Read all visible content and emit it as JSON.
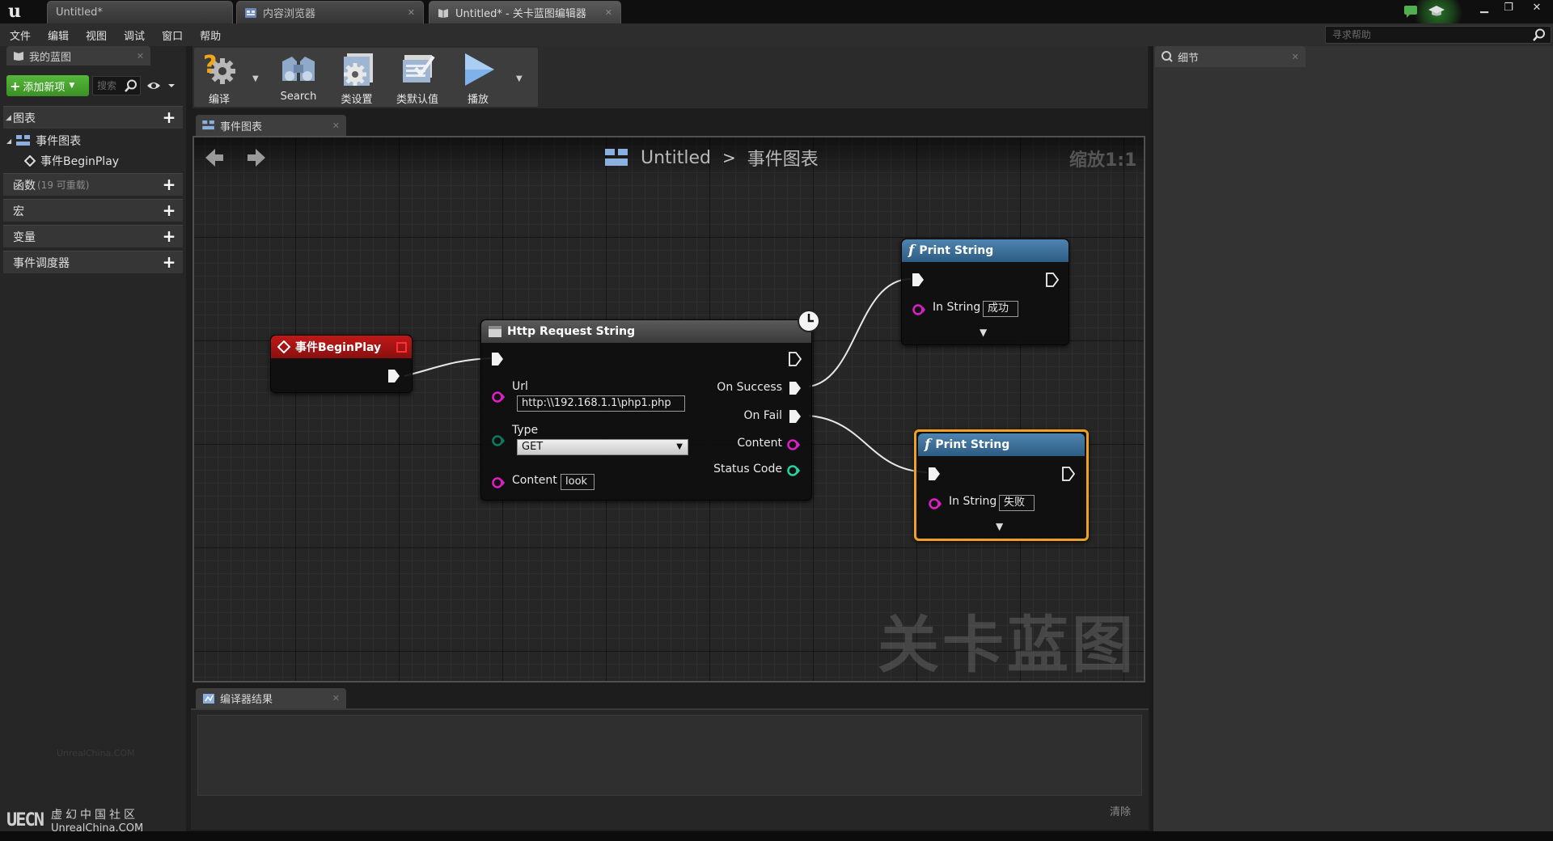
{
  "window": {
    "tabs": [
      {
        "label": "Untitled*"
      },
      {
        "label": "内容浏览器"
      },
      {
        "label": "Untitled* - 关卡蓝图编辑器"
      }
    ],
    "logo": "u"
  },
  "menu": [
    "文件",
    "编辑",
    "视图",
    "调试",
    "窗口",
    "帮助"
  ],
  "help_search_placeholder": "寻求帮助",
  "left_panel": {
    "tab_label": "我的蓝图",
    "add_button": "添加新项",
    "search_placeholder": "搜索",
    "sections": {
      "graphs": "图表",
      "event_graph": "事件图表",
      "event_beginplay": "事件BeginPlay",
      "functions": "函数",
      "functions_sub": "(19 可重载)",
      "macros": "宏",
      "variables": "变量",
      "event_dispatchers": "事件调度器"
    },
    "faint_watermark": "UnrealChina.COM",
    "community_logo": {
      "mark": "UECN",
      "line1": "虚幻中国社区",
      "line2": "UnrealChina.COM"
    }
  },
  "toolbar": {
    "compile": "编译",
    "search": "Search",
    "class_settings": "类设置",
    "class_defaults": "类默认值",
    "play": "播放"
  },
  "graph": {
    "tab_label": "事件图表",
    "breadcrumb": {
      "root": "Untitled",
      "sep": ">",
      "current": "事件图表"
    },
    "zoom": "缩放1:1",
    "watermark": "关卡蓝图",
    "nodes": {
      "begin_play": {
        "title": "事件BeginPlay"
      },
      "http": {
        "title": "Http Request String",
        "url_label": "Url",
        "url_value": "http:\\\\192.168.1.1\\php1.php",
        "type_label": "Type",
        "type_value": "GET",
        "content_label": "Content",
        "content_value": "look",
        "on_success": "On Success",
        "on_fail": "On Fail",
        "out_content": "Content",
        "status_code": "Status Code"
      },
      "print1": {
        "title": "Print String",
        "in_string_label": "In String",
        "in_string_value": "成功"
      },
      "print2": {
        "title": "Print String",
        "in_string_label": "In String",
        "in_string_value": "失败"
      }
    }
  },
  "compiler": {
    "tab_label": "编译器结果",
    "clear": "清除"
  },
  "details": {
    "tab_label": "细节"
  },
  "colors": {
    "event_header": "#b01414",
    "function_header": "#3c6f97",
    "http_header": "#4a4a4a",
    "string_pin": "#e01ec8",
    "int_pin": "#1ed6a0",
    "byte_pin": "#0a6e5a",
    "selection": "#f0a020",
    "add_button": "#4aa530"
  }
}
